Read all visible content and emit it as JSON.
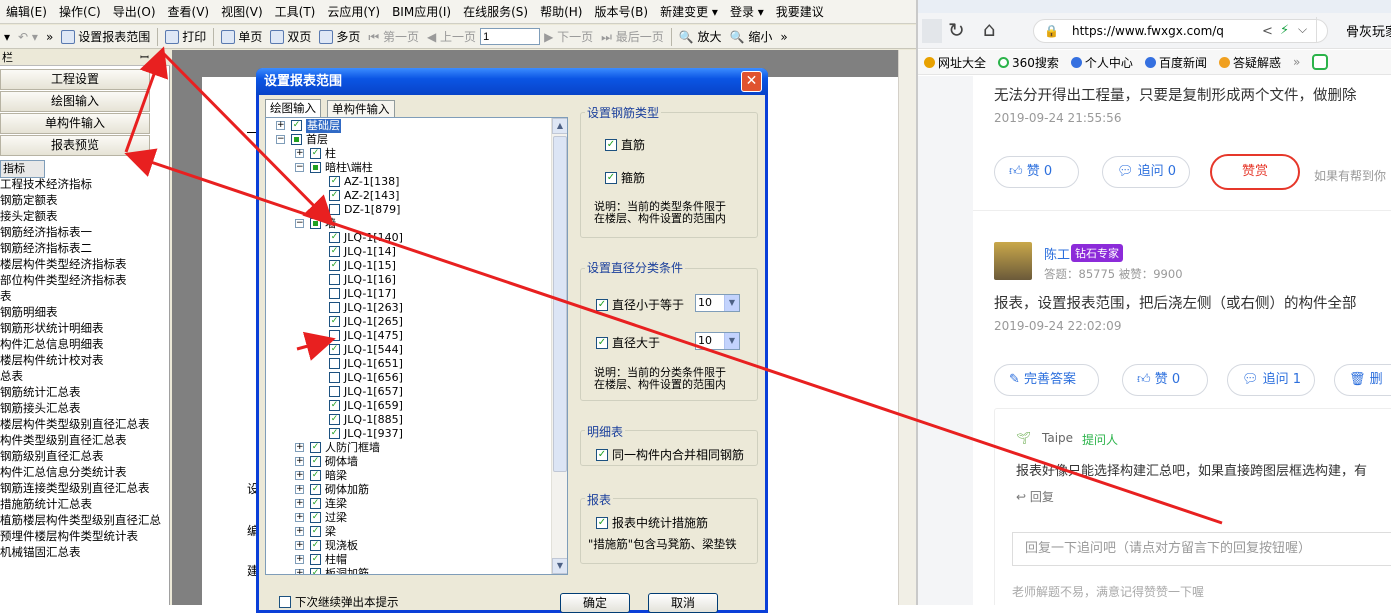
{
  "menubar": [
    "编辑(E)",
    "操作(C)",
    "导出(O)",
    "查看(V)",
    "视图(V)",
    "工具(T)",
    "云应用(Y)",
    "BIM应用(I)",
    "在线服务(S)",
    "帮助(H)",
    "版本号(B)",
    "新建变更 ▾",
    "登录 ▾",
    "我要建议"
  ],
  "toolbar": {
    "set_range": "设置报表范围",
    "print": "打印",
    "single": "单页",
    "double": "双页",
    "multi": "多页",
    "first": "第一页",
    "prev": "上一页",
    "page_value": "1",
    "next": "下一页",
    "last": "最后一页",
    "zoom_in": "放大",
    "zoom_out": "缩小"
  },
  "leftpanel": {
    "title": "栏",
    "pin": "ꟷ",
    "buttons": [
      "工程设置",
      "绘图输入",
      "单构件输入",
      "报表预览"
    ],
    "reports": [
      "指标",
      "工程技术经济指标",
      "钢筋定额表",
      "接头定额表",
      "钢筋经济指标表一",
      "钢筋经济指标表二",
      "楼层构件类型经济指标表",
      "部位构件类型经济指标表",
      "表",
      "钢筋明细表",
      "钢筋形状统计明细表",
      "构件汇总信息明细表",
      "楼层构件统计校对表",
      "总表",
      "钢筋统计汇总表",
      "钢筋接头汇总表",
      "楼层构件类型级别直径汇总表",
      "构件类型级别直径汇总表",
      "钢筋级别直径汇总表",
      "构件汇总信息分类统计表",
      "钢筋连接类型级别直径汇总表",
      "措施筋统计汇总表",
      "植筋楼层构件类型级别直径汇总",
      "预埋件楼层构件类型统计表",
      "机械锚固汇总表"
    ]
  },
  "preview": {
    "lines": [
      "设",
      "编",
      "建"
    ]
  },
  "dialog": {
    "title": "设置报表范围",
    "close": "✕",
    "tabs": [
      "绘图输入",
      "单构件输入"
    ],
    "tree": [
      {
        "lvl": 0,
        "exp": "+",
        "cb": "on",
        "label": "基础层",
        "hl": true
      },
      {
        "lvl": 0,
        "exp": "−",
        "cb": "part",
        "label": "首层"
      },
      {
        "lvl": 1,
        "exp": "+",
        "cb": "on",
        "label": "柱"
      },
      {
        "lvl": 1,
        "exp": "−",
        "cb": "part",
        "label": "暗柱\\端柱"
      },
      {
        "lvl": 2,
        "exp": "",
        "cb": "on",
        "label": "AZ-1[138]"
      },
      {
        "lvl": 2,
        "exp": "",
        "cb": "on",
        "label": "AZ-2[143]"
      },
      {
        "lvl": 2,
        "exp": "",
        "cb": "off",
        "label": "DZ-1[879]"
      },
      {
        "lvl": 1,
        "exp": "−",
        "cb": "part",
        "label": "墙"
      },
      {
        "lvl": 2,
        "exp": "",
        "cb": "on",
        "label": "JLQ-1[140]"
      },
      {
        "lvl": 2,
        "exp": "",
        "cb": "on",
        "label": "JLQ-1[14]"
      },
      {
        "lvl": 2,
        "exp": "",
        "cb": "on",
        "label": "JLQ-1[15]"
      },
      {
        "lvl": 2,
        "exp": "",
        "cb": "off",
        "label": "JLQ-1[16]"
      },
      {
        "lvl": 2,
        "exp": "",
        "cb": "off",
        "label": "JLQ-1[17]"
      },
      {
        "lvl": 2,
        "exp": "",
        "cb": "off",
        "label": "JLQ-1[263]"
      },
      {
        "lvl": 2,
        "exp": "",
        "cb": "on",
        "label": "JLQ-1[265]"
      },
      {
        "lvl": 2,
        "exp": "",
        "cb": "off",
        "label": "JLQ-1[475]"
      },
      {
        "lvl": 2,
        "exp": "",
        "cb": "on",
        "label": "JLQ-1[544]"
      },
      {
        "lvl": 2,
        "exp": "",
        "cb": "off",
        "label": "JLQ-1[651]"
      },
      {
        "lvl": 2,
        "exp": "",
        "cb": "off",
        "label": "JLQ-1[656]"
      },
      {
        "lvl": 2,
        "exp": "",
        "cb": "off",
        "label": "JLQ-1[657]"
      },
      {
        "lvl": 2,
        "exp": "",
        "cb": "on",
        "label": "JLQ-1[659]"
      },
      {
        "lvl": 2,
        "exp": "",
        "cb": "on",
        "label": "JLQ-1[885]"
      },
      {
        "lvl": 2,
        "exp": "",
        "cb": "on",
        "label": "JLQ-1[937]"
      },
      {
        "lvl": 1,
        "exp": "+",
        "cb": "on",
        "label": "人防门框墙"
      },
      {
        "lvl": 1,
        "exp": "+",
        "cb": "on",
        "label": "砌体墙"
      },
      {
        "lvl": 1,
        "exp": "+",
        "cb": "on",
        "label": "暗梁"
      },
      {
        "lvl": 1,
        "exp": "+",
        "cb": "on",
        "label": "砌体加筋"
      },
      {
        "lvl": 1,
        "exp": "+",
        "cb": "on",
        "label": "连梁"
      },
      {
        "lvl": 1,
        "exp": "+",
        "cb": "on",
        "label": "过梁"
      },
      {
        "lvl": 1,
        "exp": "+",
        "cb": "on",
        "label": "梁"
      },
      {
        "lvl": 1,
        "exp": "+",
        "cb": "on",
        "label": "现浇板"
      },
      {
        "lvl": 1,
        "exp": "+",
        "cb": "on",
        "label": "柱帽"
      },
      {
        "lvl": 1,
        "exp": "+",
        "cb": "on",
        "label": "板洞加筋"
      }
    ],
    "g1": {
      "title": "设置钢筋类型",
      "opt1": "直筋",
      "opt2": "箍筋",
      "note1": "说明：当前的类型条件限于",
      "note2": "在楼层、构件设置的范围内"
    },
    "g2": {
      "title": "设置直径分类条件",
      "opt1": "直径小于等于",
      "val1": "10",
      "opt2": "直径大于",
      "val2": "10",
      "note1": "说明：当前的分类条件限于",
      "note2": "在楼层、构件设置的范围内"
    },
    "g3": {
      "title": "明细表",
      "opt1": "同一构件内合并相同钢筋"
    },
    "g4": {
      "title": "报表",
      "opt1": "报表中统计措施筋",
      "note": "\"措施筋\"包含马凳筋、梁垫铁"
    },
    "footer_check": "下次继续弹出本提示",
    "ok": "确定",
    "cancel": "取消"
  },
  "browser": {
    "url": "https://www.fwxgx.com/q",
    "search_hint": "骨灰玩家",
    "bookmarks": [
      "网址大全",
      "360搜索",
      "个人中心",
      "百度新闻",
      "答疑解惑"
    ],
    "answer1": {
      "text": "无法分开得出工程量，只要是复制形成两个文件，做删除",
      "time": "2019-09-24 21:55:56",
      "like": "赞 0",
      "ask": "追问 0",
      "reward": "赞赏",
      "hint": "如果有帮到你"
    },
    "answer2": {
      "name": "陈工",
      "badge": "钻石专家",
      "stats": "答题：85775    被赞：9900",
      "text": "报表，设置报表范围，把后浇左侧（或右侧）的构件全部",
      "time": "2019-09-24 22:02:09",
      "improve": "完善答案",
      "like": "赞 0",
      "ask": "追问 1",
      "del": "删"
    },
    "followup": {
      "name": "Taipe",
      "role": "提问人",
      "text": "报表好像只能选择构建汇总吧，如果直接跨图层框选构建，有",
      "reply": "回复"
    },
    "reply_placeholder": "回复一下追问吧（请点对方留言下的回复按钮喔）",
    "footer": "老师解题不易，满意记得赞赞一下喔"
  },
  "colors": {
    "xp_blue": "#0b55e4",
    "accent_red": "#e6372a",
    "link_blue": "#2c6fdd",
    "badge_purple": "#8c2bd9",
    "annot_red": "#e82020"
  }
}
